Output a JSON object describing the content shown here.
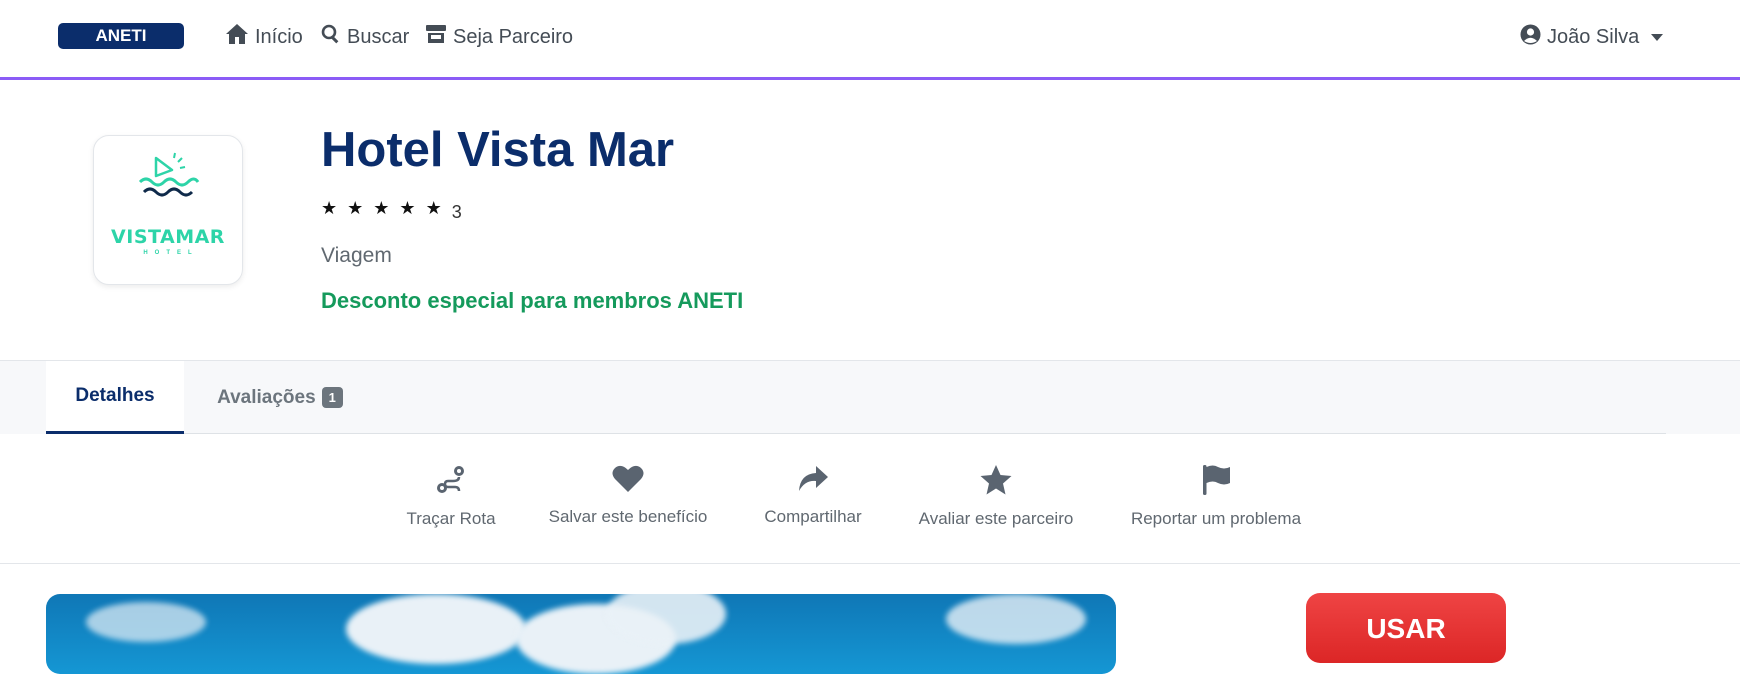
{
  "navbar": {
    "brand": "ANETI",
    "links": [
      {
        "label": "Início",
        "icon": "home-icon"
      },
      {
        "label": "Buscar",
        "icon": "search-icon"
      },
      {
        "label": "Seja Parceiro",
        "icon": "store-icon"
      }
    ],
    "user": {
      "name": "João Silva",
      "icon": "user-circle-icon"
    },
    "accent_color": "#8b5cf6"
  },
  "partner": {
    "logo": {
      "word": "VISTAMAR",
      "sub": "HOTEL"
    },
    "name": "Hotel Vista Mar",
    "rating": {
      "stars": 5,
      "max": 5,
      "count": "3"
    },
    "category": "Viagem",
    "promo": "Desconto especial para membros ANETI",
    "title_color": "#0b2d6b",
    "promo_color": "#159a5c"
  },
  "tabs": [
    {
      "label": "Detalhes",
      "active": true
    },
    {
      "label": "Avaliações",
      "badge": "1",
      "active": false
    }
  ],
  "actions": [
    {
      "label": "Traçar Rota",
      "icon": "route-icon"
    },
    {
      "label": "Salvar este benefício",
      "icon": "heart-icon"
    },
    {
      "label": "Compartilhar",
      "icon": "share-icon"
    },
    {
      "label": "Avaliar este parceiro",
      "icon": "star-icon"
    },
    {
      "label": "Reportar um problema",
      "icon": "flag-icon"
    }
  ],
  "use_button": {
    "label": "USAR",
    "color": "#dc2626"
  }
}
